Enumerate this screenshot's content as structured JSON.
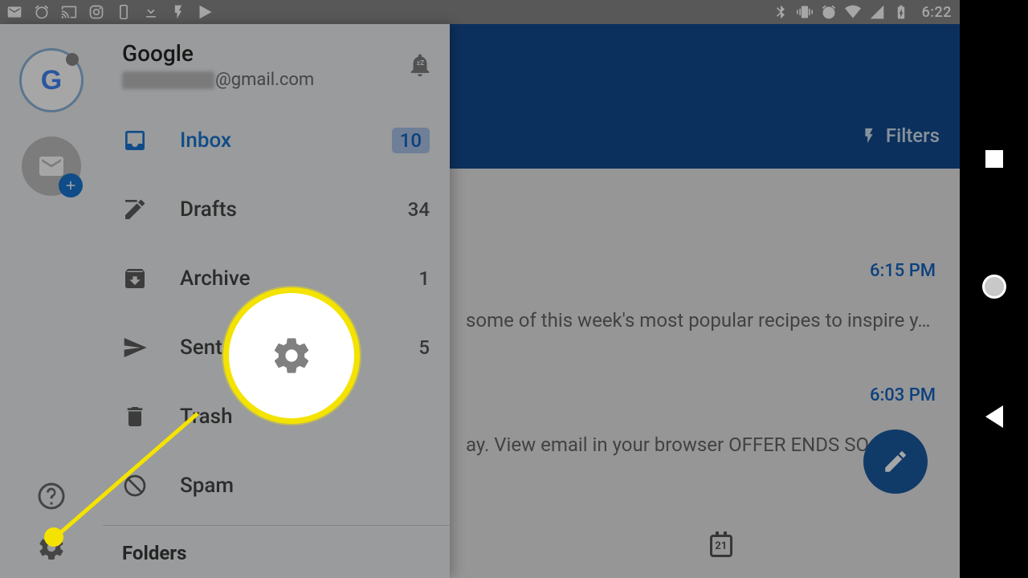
{
  "status_bar": {
    "time": "6:22"
  },
  "bottom_bar": {
    "calendar_day": "21"
  },
  "header": {
    "filters_label": "Filters"
  },
  "drawer": {
    "account_name": "Google",
    "account_email_suffix": "@gmail.com",
    "folders": [
      {
        "label": "Inbox",
        "count": "10"
      },
      {
        "label": "Drafts",
        "count": "34"
      },
      {
        "label": "Archive",
        "count": "1"
      },
      {
        "label": "Sent",
        "count": "5"
      },
      {
        "label": "Trash",
        "count": ""
      },
      {
        "label": "Spam",
        "count": ""
      }
    ],
    "section_label": "Folders"
  },
  "emails": [
    {
      "time": "6:15 PM",
      "snippet": "some of this week's most popular recipes to inspire y…"
    },
    {
      "time": "6:03 PM",
      "snippet": "ay. View email in your browser OFFER ENDS SO"
    }
  ]
}
